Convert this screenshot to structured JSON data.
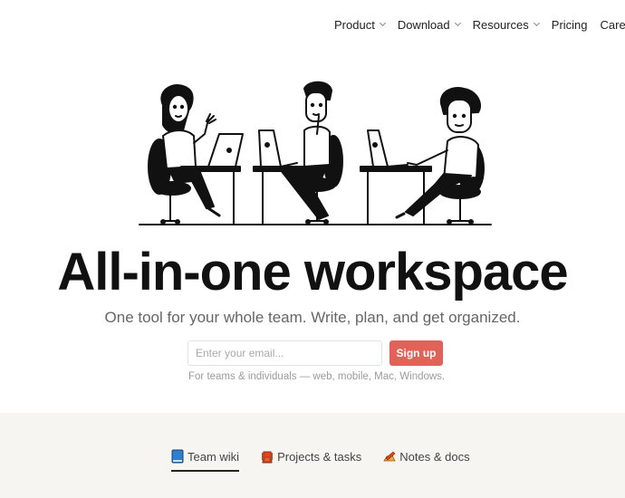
{
  "nav": {
    "items": [
      {
        "label": "Product",
        "has_dropdown": true
      },
      {
        "label": "Download",
        "has_dropdown": true
      },
      {
        "label": "Resources",
        "has_dropdown": true
      },
      {
        "label": "Pricing",
        "has_dropdown": false
      },
      {
        "label": "Careers",
        "has_dropdown": false
      }
    ]
  },
  "hero": {
    "illustration": "three-people-working-at-laptops-illustration",
    "headline": "All-in-one workspace",
    "subheadline": "One tool for your whole team. Write, plan, and get organized.",
    "email_placeholder": "Enter your email...",
    "email_value": "",
    "signup_label": "Sign up",
    "platforms_note": "For teams & individuals — web, mobile, Mac, Windows."
  },
  "colors": {
    "accent": "#e16259",
    "beige_section": "#f7f5f2",
    "text_primary": "#111111",
    "text_muted": "#9b9b9b"
  },
  "tabs": {
    "items": [
      {
        "label": "Team wiki",
        "icon": "blue-book-icon",
        "active": true
      },
      {
        "label": "Projects & tasks",
        "icon": "red-backpack-icon",
        "active": false
      },
      {
        "label": "Notes & docs",
        "icon": "pencil-memo-icon",
        "active": false
      }
    ]
  }
}
